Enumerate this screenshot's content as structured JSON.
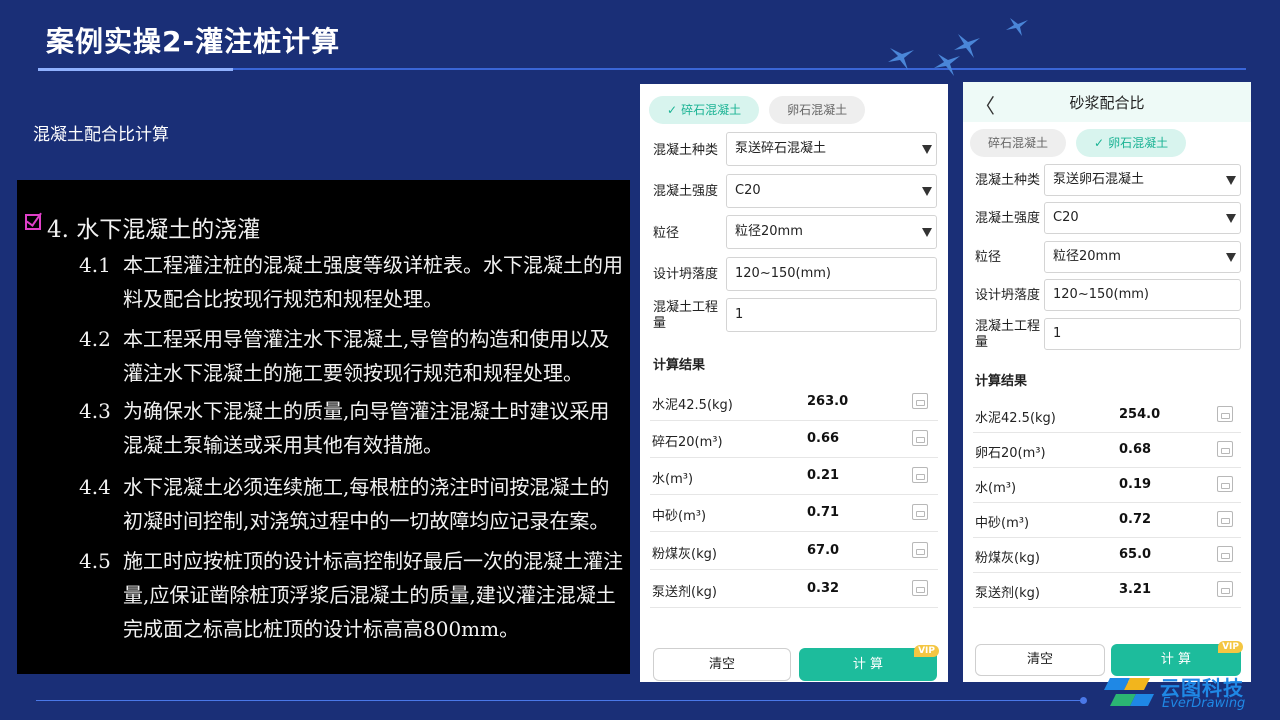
{
  "slide": {
    "title": "案例实操2-灌注桩计算",
    "section_label": "混凝土配合比计算"
  },
  "cad": {
    "heading": "4. 水下混凝土的浇灌",
    "items": [
      {
        "num": "4.1",
        "text": "本工程灌注桩的混凝土强度等级详桩表。水下混凝土的用料及配合比按现行规范和规程处理。"
      },
      {
        "num": "4.2",
        "text": "本工程采用导管灌注水下混凝土,导管的构造和使用以及灌注水下混凝土的施工要领按现行规范和规程处理。"
      },
      {
        "num": "4.3",
        "text": "为确保水下混凝土的质量,向导管灌注混凝土时建议采用混凝土泵输送或采用其他有效措施。"
      },
      {
        "num": "4.4",
        "text": "水下混凝土必须连续施工,每根桩的浇注时间按混凝土的初凝时间控制,对浇筑过程中的一切故障均应记录在案。"
      },
      {
        "num": "4.5",
        "text": "施工时应按桩顶的设计标高控制好最后一次的混凝土灌注量,应保证凿除桩顶浮浆后混凝土的质量,建议灌注混凝土完成面之标高比桩顶的设计标高高800mm。"
      }
    ]
  },
  "app1": {
    "tabs": [
      {
        "label": "碎石混凝土",
        "active": true
      },
      {
        "label": "卵石混凝土",
        "active": false
      }
    ],
    "check_glyph": "✓",
    "form": [
      {
        "label": "混凝土种类",
        "value": "泵送碎石混凝土",
        "type": "select"
      },
      {
        "label": "混凝土强度",
        "value": "C20",
        "type": "select"
      },
      {
        "label": "粒径",
        "value": "粒径20mm",
        "type": "select"
      },
      {
        "label": "设计坍落度",
        "value": "120~150(mm)",
        "type": "input"
      },
      {
        "label": "混凝土工程量",
        "value": "1",
        "type": "input"
      }
    ],
    "results_heading": "计算结果",
    "results": [
      {
        "label": "水泥42.5(kg)",
        "value": "263.0"
      },
      {
        "label": "碎石20(m³)",
        "value": "0.66"
      },
      {
        "label": "水(m³)",
        "value": "0.21"
      },
      {
        "label": "中砂(m³)",
        "value": "0.71"
      },
      {
        "label": "粉煤灰(kg)",
        "value": "67.0"
      },
      {
        "label": "泵送剂(kg)",
        "value": "0.32"
      }
    ],
    "clear_label": "清空",
    "calc_label": "计 算",
    "vip_label": "VIP"
  },
  "app2": {
    "header_title": "砂浆配合比",
    "back_glyph": "〈",
    "tabs": [
      {
        "label": "碎石混凝土",
        "active": false
      },
      {
        "label": "卵石混凝土",
        "active": true
      }
    ],
    "check_glyph": "✓",
    "form": [
      {
        "label": "混凝土种类",
        "value": "泵送卵石混凝土",
        "type": "select"
      },
      {
        "label": "混凝土强度",
        "value": "C20",
        "type": "select"
      },
      {
        "label": "粒径",
        "value": "粒径20mm",
        "type": "select"
      },
      {
        "label": "设计坍落度",
        "value": "120~150(mm)",
        "type": "input"
      },
      {
        "label": "混凝土工程量",
        "value": "1",
        "type": "input"
      }
    ],
    "results_heading": "计算结果",
    "results": [
      {
        "label": "水泥42.5(kg)",
        "value": "254.0"
      },
      {
        "label": "卵石20(m³)",
        "value": "0.68"
      },
      {
        "label": "水(m³)",
        "value": "0.19"
      },
      {
        "label": "中砂(m³)",
        "value": "0.72"
      },
      {
        "label": "粉煤灰(kg)",
        "value": "65.0"
      },
      {
        "label": "泵送剂(kg)",
        "value": "3.21"
      }
    ],
    "clear_label": "清空",
    "calc_label": "计 算",
    "vip_label": "VIP"
  },
  "logo": {
    "cn": "云图科技",
    "en": "EverDrawing"
  },
  "colors": {
    "background": "#1a2f77",
    "accent": "#1dbc9c",
    "vip": "#f4c642"
  }
}
